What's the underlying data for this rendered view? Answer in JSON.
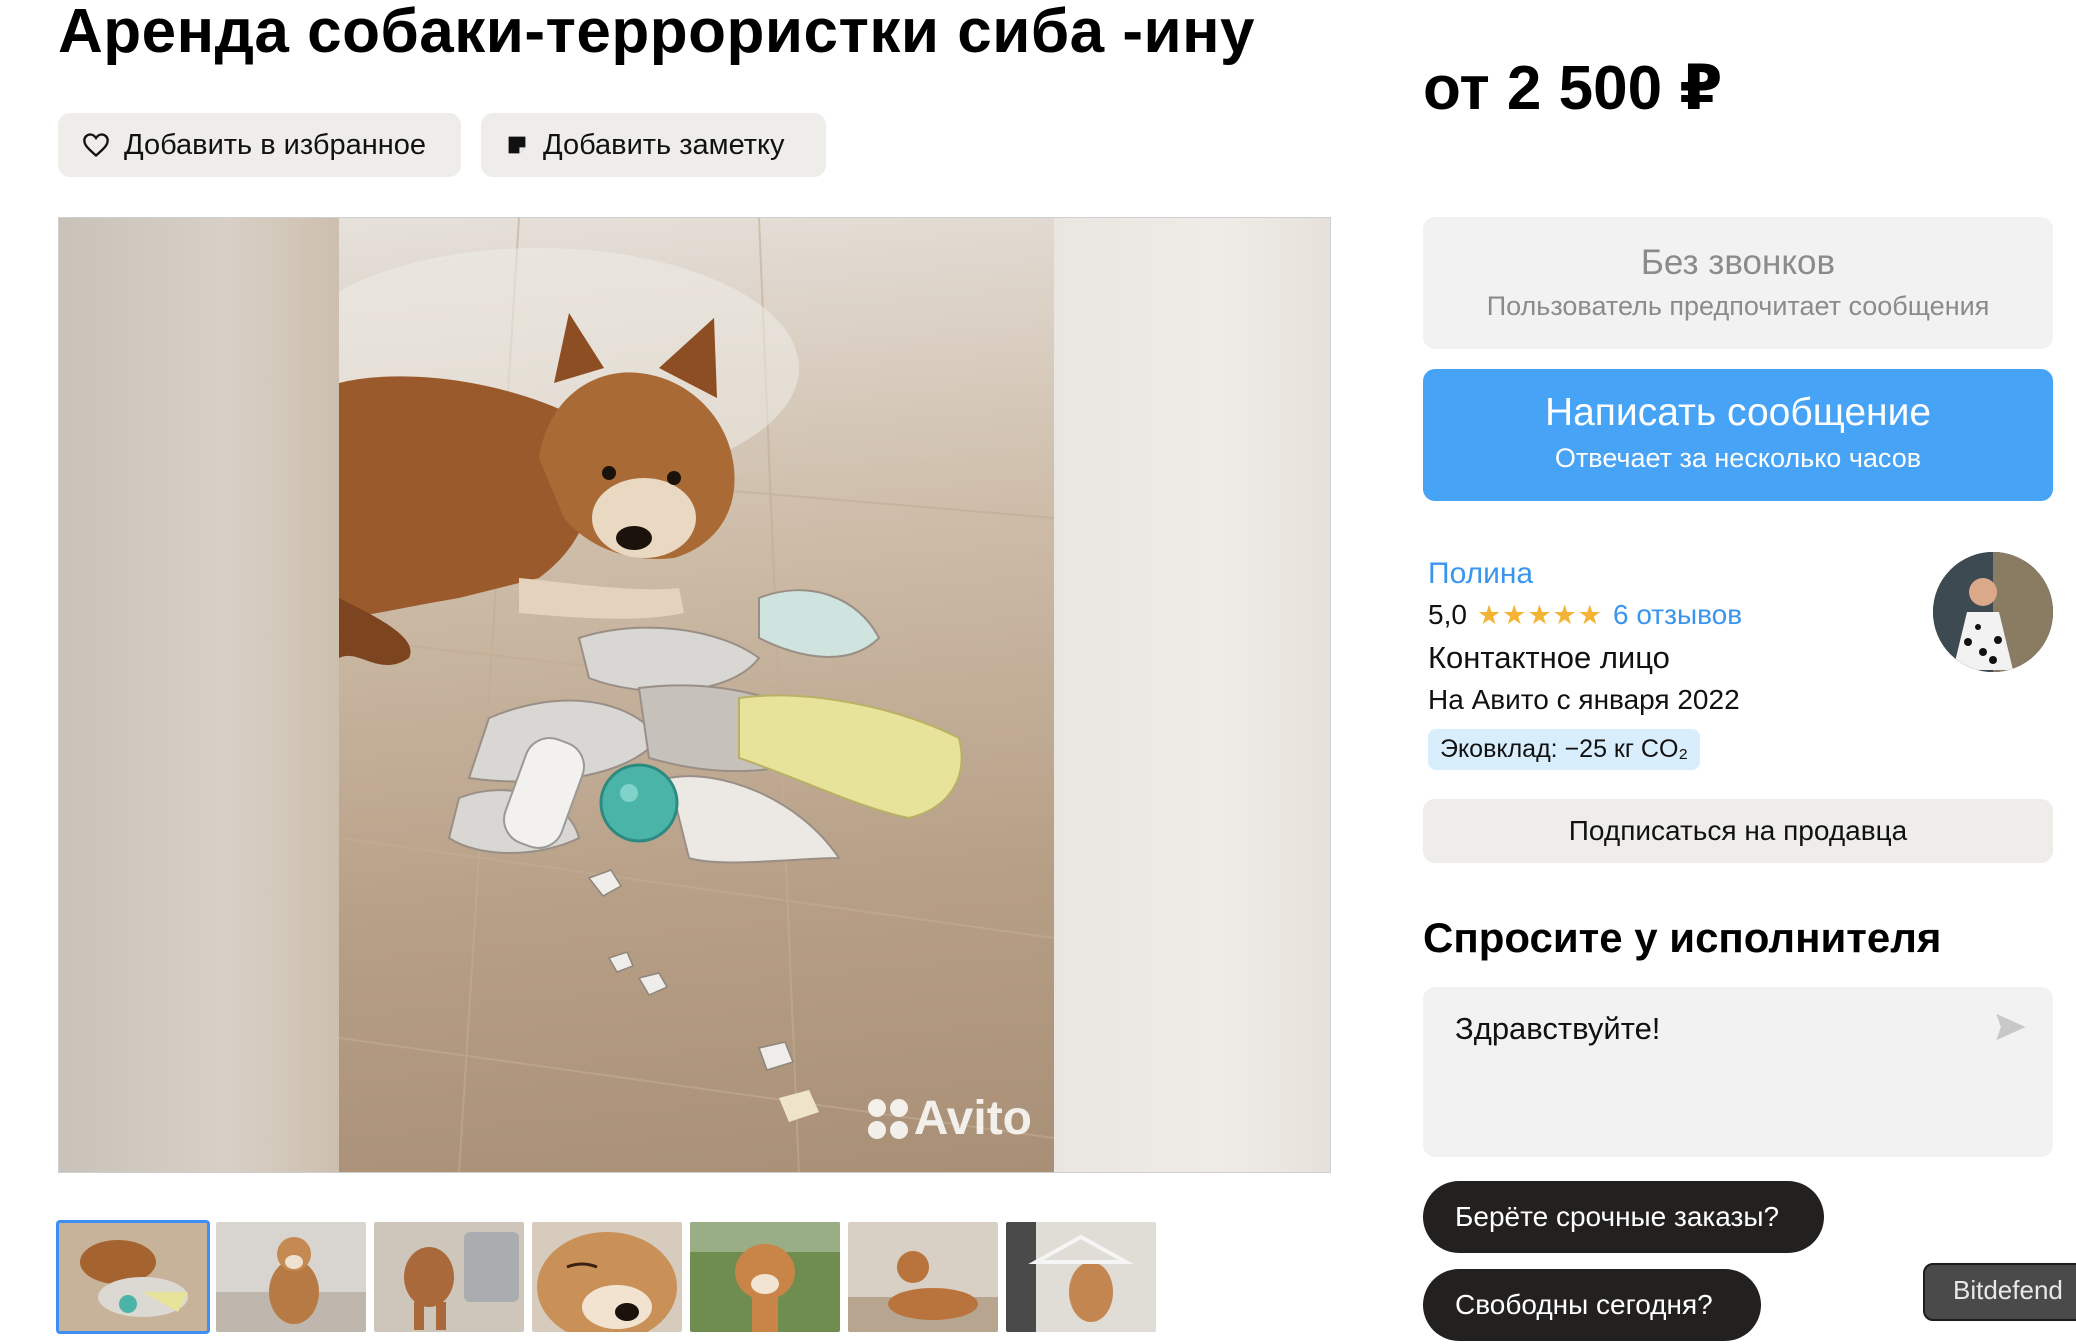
{
  "listing": {
    "title": "Аренда собаки-террористки сиба -ину",
    "price": "от 2 500 ₽"
  },
  "actions": {
    "favorite_label": "Добавить в избранное",
    "note_label": "Добавить заметку"
  },
  "gallery": {
    "watermark": "Avito",
    "thumbnail_count": 7,
    "active_thumbnail": 1
  },
  "contact": {
    "no_calls_title": "Без звонков",
    "no_calls_subtitle": "Пользователь предпочитает сообщения",
    "message_button_label": "Написать сообщение",
    "message_button_subtitle": "Отвечает за несколько часов"
  },
  "seller": {
    "name": "Полина",
    "rating": "5,0",
    "stars": "★★★★★",
    "reviews": "6 отзывов",
    "role": "Контактное лицо",
    "since": "На Авито с января 2022",
    "eco_badge": "Эковклад: −25 кг CO₂",
    "subscribe_label": "Подписаться на продавца"
  },
  "ask": {
    "title": "Спросите у исполнителя",
    "input_value": "Здравствуйте!",
    "quick_replies": [
      "Берёте срочные заказы?",
      "Свободны сегодня?"
    ]
  },
  "extension": {
    "tab_label": "Bitdefend"
  },
  "colors": {
    "accent_blue": "#47a3f6",
    "link_blue": "#3a95ee",
    "star_yellow": "#f5b335",
    "chip_dark": "#23211f",
    "eco_bg": "#d9eefc"
  }
}
